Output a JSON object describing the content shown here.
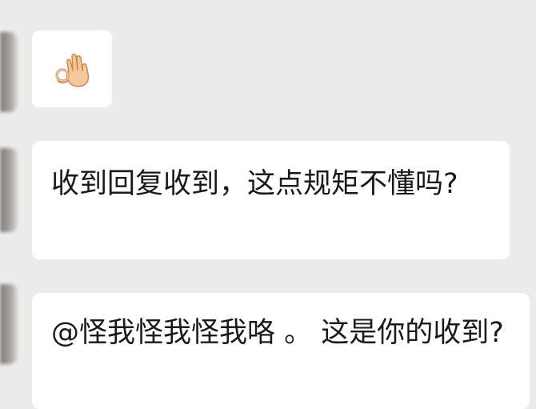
{
  "messages": [
    {
      "type": "emoji",
      "icon": "ok-hand-icon"
    },
    {
      "type": "text",
      "text": "收到回复收到，这点规矩不懂吗?"
    },
    {
      "type": "text",
      "text": "@怪我怪我怪我咯 。 这是你的收到?"
    }
  ]
}
